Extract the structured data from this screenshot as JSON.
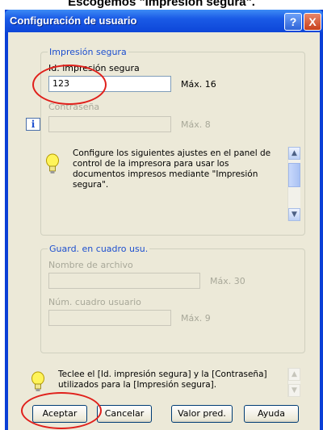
{
  "caption": "Escogemos \"Impresión segura\".",
  "window": {
    "title": "Configuración de usuario",
    "help_button": "?",
    "close_button": "X"
  },
  "secure_print": {
    "group_label": "Impresión segura",
    "id_label": "Id. impresión segura",
    "id_value": "123",
    "id_max": "Máx. 16",
    "password_label": "Contraseña",
    "password_value": "",
    "password_max": "Máx. 8",
    "note": "Configure los siguientes ajustes en el panel de control de la impresora para usar los documentos impresos mediante \"Impresión segura\"."
  },
  "save_in_box": {
    "group_label": "Guard. en cuadro usu.",
    "file_name_label": "Nombre de archivo",
    "file_name_value": "",
    "file_name_max": "Máx. 30",
    "box_number_label": "Núm. cuadro usuario",
    "box_number_value": "",
    "box_number_max": "Máx. 9"
  },
  "bottom_note": "Teclee el [Id. impresión segura] y la [Contraseña] utilizados para la [Impresión segura].",
  "buttons": {
    "ok": "Aceptar",
    "cancel": "Cancelar",
    "defaults": "Valor pred.",
    "help": "Ayuda"
  },
  "colors": {
    "title_bar": "#0d46d8",
    "dialog_bg": "#ece9d8",
    "group_label": "#1d4fcf",
    "highlight_ring": "#e0201b"
  }
}
